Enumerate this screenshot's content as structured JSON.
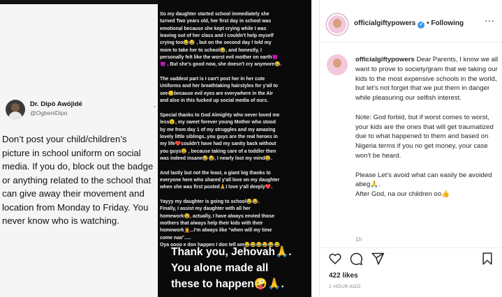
{
  "tweet": {
    "author_name": "Dr. Dipò Awójìdé",
    "author_handle": "@OgbeniDipo",
    "text": "Don’t post your child/children’s\npicture in school uniform on social\nmedia. If you do, block out the badge\nor anything related to the school that\ncan give away their movement and\nlocation from Monday to Friday. You\nnever know who is watching."
  },
  "story": {
    "text": "So my daughter started school immediately she\nturned Two years old, her first day in school was\nemotional because she kept crying while I was\nleaving out of her class and I couldn't help myself\ncrying too😂😂 , but on the second day I told my\nmom to take her to school😂, and honestly, I\npersonally felt like the worst evil mother on earth😈\n😈 . But she's good now, she doesn't cry anymore😂.\n\nThe saddest part is I can't post her in her cute\nUniforms and her breathtaking hairstyles for y'all to\nsee😒because evil eyes are everywhere in the Air\nand also in this fucked up social media of ours.\n\nSpecial thanks to God Almighty who never loved me\nless😉, my sweet forever young Mother who stood\nby me from day 1 of my struggles and my amazing\nlovely little siblings..you guys are the real heroes in\nmy life❤️couldn't have had my sanity back without\nyou guys😩 , because taking care of a toddler then\nwas indeed insane😂😂, I nearly lost my mind😩.\n\nAnd lastly but not the least, a giant big thanks to\neveryone here who shared y'all love on my daughter\nwhen she was first posted🙏I love y'all deeply❤️.\n\nYayyy my daughter is going to school😂😂.\nFinally, I assist my daughter with all her\nhomework😩, actually, I have always envied those\nmothers that always help their kids with their\nhomework🤦...I'm always like \"when will my time\ncome naa\".....\nOya oooo e don happen I don tell am😂😂😂😂😂😂",
    "big_text": "Thank you, Jehovah🙏.\nYou alone made all\nthese to happen🤪🙏."
  },
  "instagram": {
    "username": "officialgiftypowers",
    "following_label": "• Following",
    "more_label": "···",
    "caption_user": "officialgiftypowers",
    "caption_text": "Dear Parents, I know we all want to prove to society/gram that we taking our kids to the most expensive schools in the world, but let's not forget that we put them in danger while pleasuring our selfish interest.\n\nNote: God forbid, but if worst comes to worst, your kids are the ones that will get traumatized due to what happened to them and based on Nigeria terms if you no get money, your case won't be heard.\n\nPlease Let's avoid what can easily be avoided abeg🙏.\nAfter God, na our children oo👍",
    "caption_time": "1h",
    "likes": "422 likes",
    "posted_ago": "1 HOUR AGO",
    "accent_color": "#3897f0"
  },
  "icons": {
    "verified": "verified-badge-icon",
    "heart": "heart-icon",
    "comment": "comment-icon",
    "share": "share-icon",
    "bookmark": "bookmark-icon",
    "more": "more-options-icon"
  }
}
